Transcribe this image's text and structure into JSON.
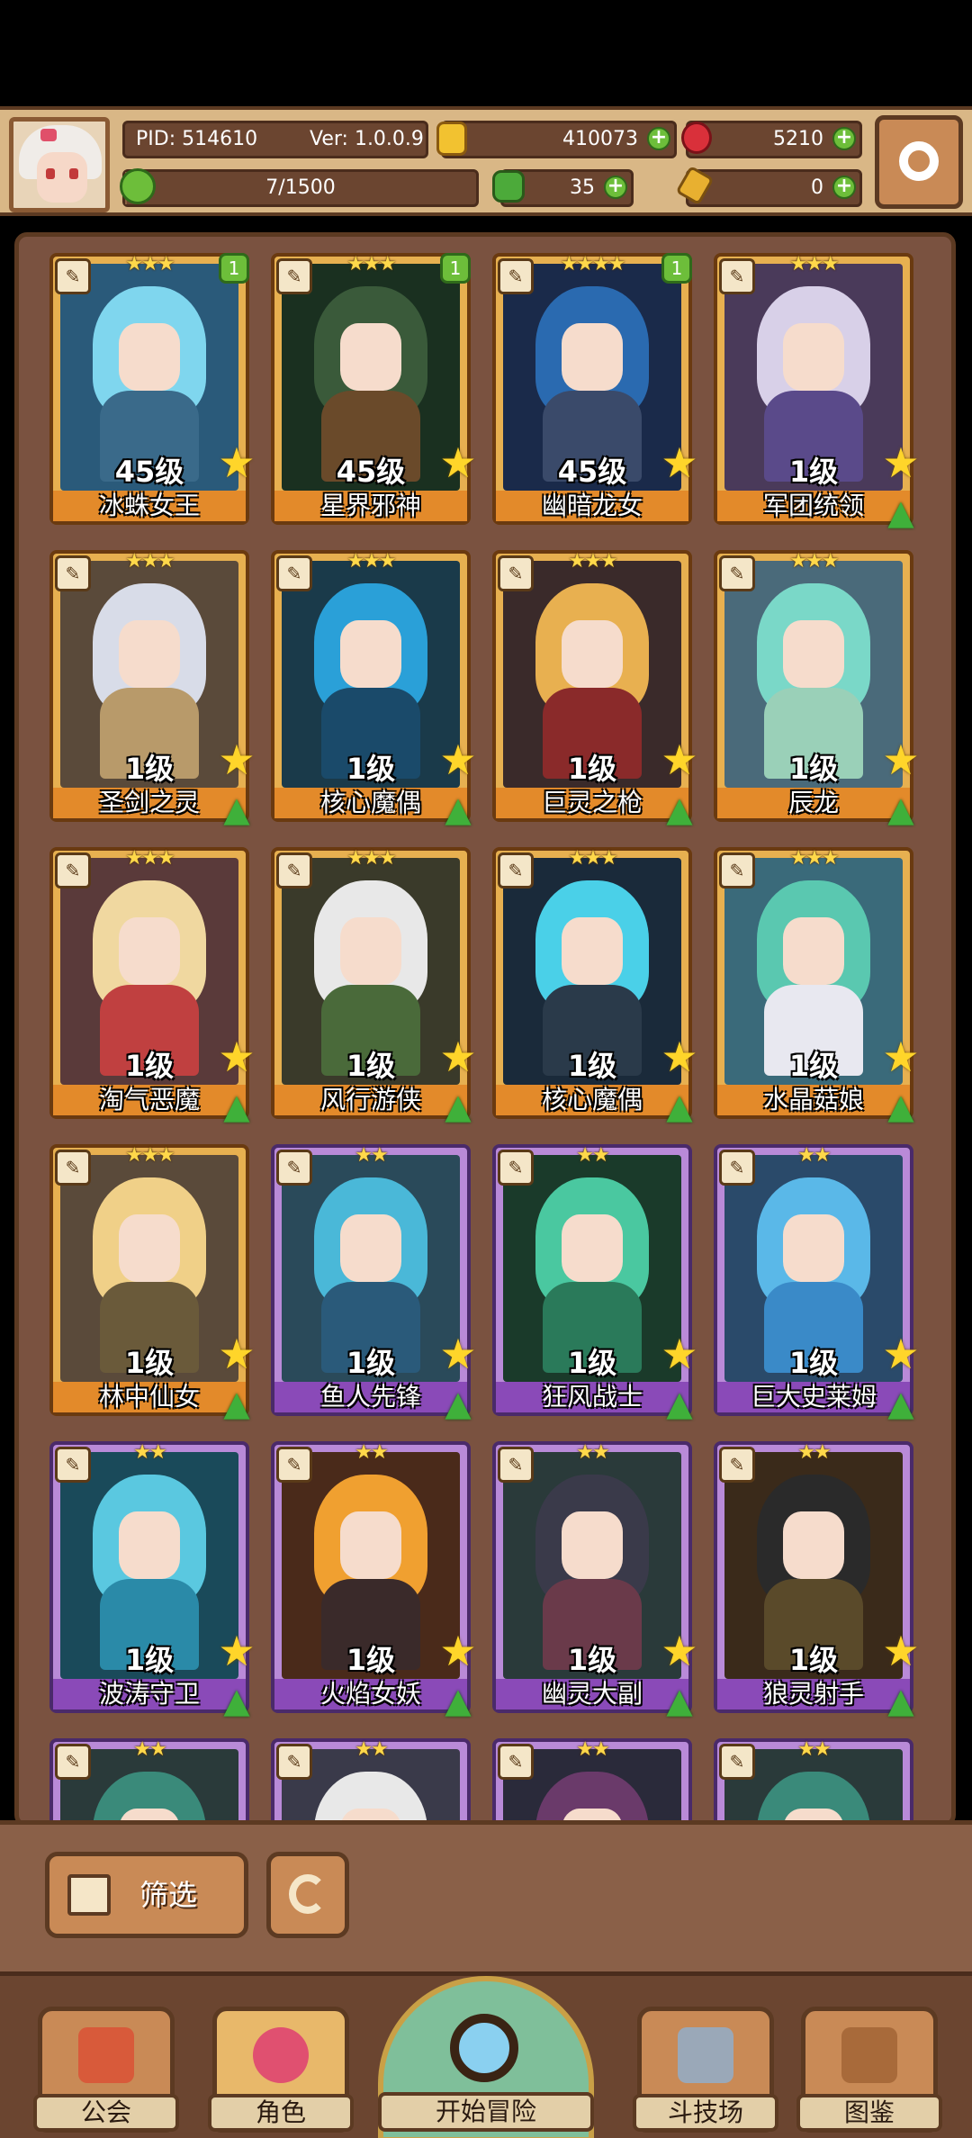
{
  "header": {
    "pid": "PID: 514610",
    "version": "Ver: 1.0.0.9",
    "gold": "410073",
    "gems": "5210",
    "exp": "7/1500",
    "exp_progress": 0.0047,
    "clover": "35",
    "keys": "0"
  },
  "cards": [
    {
      "name": "冰蛛女王",
      "level": "45级",
      "stars": "★★★",
      "badge": "1",
      "frame": "gold",
      "hair": "#7fd6ee",
      "body": "#3a6a8a",
      "bg": "#2a5a7a",
      "show_up": false
    },
    {
      "name": "星界邪神",
      "level": "45级",
      "stars": "★★★",
      "badge": "1",
      "frame": "gold",
      "hair": "#3a5a3a",
      "body": "#6a4a2a",
      "bg": "#1a3020",
      "show_up": false
    },
    {
      "name": "幽暗龙女",
      "level": "45级",
      "stars": "★★★★",
      "badge": "1",
      "frame": "gold",
      "hair": "#2a6ab0",
      "body": "#3a4a6a",
      "bg": "#1a2a4a",
      "show_up": false
    },
    {
      "name": "军团统领",
      "level": "1级",
      "stars": "★★★",
      "badge": "",
      "frame": "gold",
      "hair": "#d8d0e8",
      "body": "#5a4a8a",
      "bg": "#4a3a5a",
      "show_up": true
    },
    {
      "name": "圣剑之灵",
      "level": "1级",
      "stars": "★★★",
      "badge": "",
      "frame": "gold",
      "hair": "#d8dce8",
      "body": "#b89a6a",
      "bg": "#5a4a3a",
      "show_up": true
    },
    {
      "name": "核心魔偶",
      "level": "1级",
      "stars": "★★★",
      "badge": "",
      "frame": "gold",
      "hair": "#2aa0d8",
      "body": "#1a4a6a",
      "bg": "#1a3a4a",
      "show_up": true
    },
    {
      "name": "巨灵之枪",
      "level": "1级",
      "stars": "★★★",
      "badge": "",
      "frame": "gold",
      "hair": "#e8b050",
      "body": "#8a2a2a",
      "bg": "#3a2a2a",
      "show_up": true
    },
    {
      "name": "辰龙",
      "level": "1级",
      "stars": "★★★",
      "badge": "",
      "frame": "gold",
      "hair": "#7ad8c8",
      "body": "#9ad0b8",
      "bg": "#4a6a7a",
      "show_up": true
    },
    {
      "name": "淘气恶魔",
      "level": "1级",
      "stars": "★★★",
      "badge": "",
      "frame": "gold",
      "hair": "#f0d8a0",
      "body": "#c04040",
      "bg": "#5a3a3a",
      "show_up": true
    },
    {
      "name": "风行游侠",
      "level": "1级",
      "stars": "★★★",
      "badge": "",
      "frame": "gold",
      "hair": "#e8e8e8",
      "body": "#4a6a3a",
      "bg": "#3a3a2a",
      "show_up": true
    },
    {
      "name": "核心魔偶",
      "level": "1级",
      "stars": "★★★",
      "badge": "",
      "frame": "gold",
      "hair": "#4ad0e8",
      "body": "#2a3a4a",
      "bg": "#1a2a3a",
      "show_up": true
    },
    {
      "name": "水晶菇娘",
      "level": "1级",
      "stars": "★★★",
      "badge": "",
      "frame": "gold",
      "hair": "#5ac8b0",
      "body": "#e8e8f0",
      "bg": "#3a6a7a",
      "show_up": true
    },
    {
      "name": "林中仙女",
      "level": "1级",
      "stars": "★★★",
      "badge": "",
      "frame": "gold",
      "hair": "#f0d088",
      "body": "#6a5a3a",
      "bg": "#5a4a3a",
      "show_up": true
    },
    {
      "name": "鱼人先锋",
      "level": "1级",
      "stars": "★★",
      "badge": "",
      "frame": "purple",
      "hair": "#4ab8d8",
      "body": "#2a5a7a",
      "bg": "#2a4a5a",
      "show_up": true
    },
    {
      "name": "狂风战士",
      "level": "1级",
      "stars": "★★",
      "badge": "",
      "frame": "purple",
      "hair": "#4ac8a0",
      "body": "#2a7a5a",
      "bg": "#1a3a2a",
      "show_up": true
    },
    {
      "name": "巨大史莱姆",
      "level": "1级",
      "stars": "★★",
      "badge": "",
      "frame": "purple",
      "hair": "#5ab8e8",
      "body": "#3a8ac8",
      "bg": "#2a4a6a",
      "show_up": true
    },
    {
      "name": "波涛守卫",
      "level": "1级",
      "stars": "★★",
      "badge": "",
      "frame": "purple",
      "hair": "#5ac8e0",
      "body": "#2a8aa8",
      "bg": "#1a4a5a",
      "show_up": true
    },
    {
      "name": "火焰女妖",
      "level": "1级",
      "stars": "★★",
      "badge": "",
      "frame": "purple",
      "hair": "#f0a030",
      "body": "#3a2a2a",
      "bg": "#4a2a1a",
      "show_up": true
    },
    {
      "name": "幽灵大副",
      "level": "1级",
      "stars": "★★",
      "badge": "",
      "frame": "purple",
      "hair": "#3a3a4a",
      "body": "#6a3a4a",
      "bg": "#2a3a3a",
      "show_up": true
    },
    {
      "name": "狼灵射手",
      "level": "1级",
      "stars": "★★",
      "badge": "",
      "frame": "purple",
      "hair": "#2a2a2a",
      "body": "#5a4a2a",
      "bg": "#3a2a1a",
      "show_up": true
    },
    {
      "name": "",
      "level": "",
      "stars": "★★",
      "badge": "",
      "frame": "purple",
      "hair": "#3a8a7a",
      "body": "#3a6a5a",
      "bg": "#2a3a3a",
      "show_up": false
    },
    {
      "name": "",
      "level": "",
      "stars": "★★",
      "badge": "",
      "frame": "purple",
      "hair": "#e8e8e8",
      "body": "#aaaaaa",
      "bg": "#3a3a4a",
      "show_up": false
    },
    {
      "name": "",
      "level": "",
      "stars": "★★",
      "badge": "",
      "frame": "purple",
      "hair": "#6a3a6a",
      "body": "#5a3a5a",
      "bg": "#2a2a3a",
      "show_up": false
    },
    {
      "name": "",
      "level": "",
      "stars": "★★",
      "badge": "",
      "frame": "purple",
      "hair": "#3a8a7a",
      "body": "#a03a3a",
      "bg": "#2a3a3a",
      "show_up": false
    }
  ],
  "toolbar": {
    "filter_label": "筛选"
  },
  "nav": {
    "guild": "公会",
    "character": "角色",
    "start": "开始冒险",
    "arena": "斗技场",
    "album": "图鉴"
  },
  "colors": {
    "gold_frame": "#e7b050",
    "purple_frame": "#b98ad8",
    "plus_green": "#6dbe3a"
  }
}
